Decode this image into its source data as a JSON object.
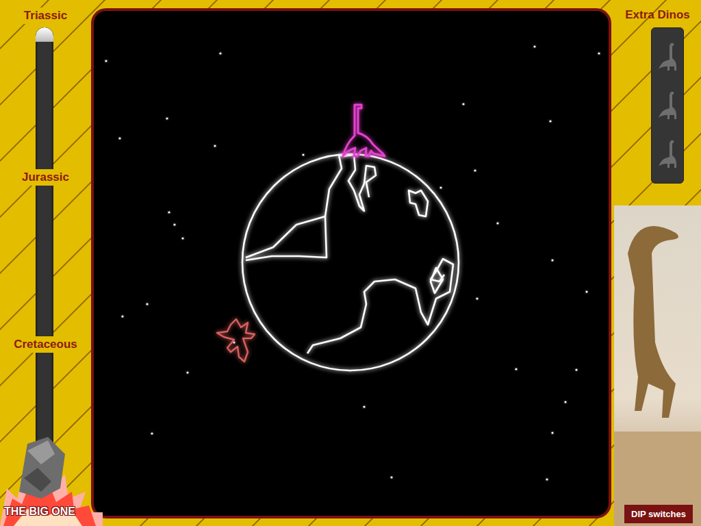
{
  "eras": [
    {
      "label": "Triassic"
    },
    {
      "label": "Jurassic"
    },
    {
      "label": "Cretaceous"
    }
  ],
  "era_slider": {
    "level": 0.03
  },
  "big_one": {
    "label": "THE BIG ONE"
  },
  "extra_dinos": {
    "label": "Extra Dinos",
    "lives": [
      {
        "active": false
      },
      {
        "active": false
      },
      {
        "active": false
      }
    ]
  },
  "dip_switches": {
    "label": "DIP switches"
  }
}
